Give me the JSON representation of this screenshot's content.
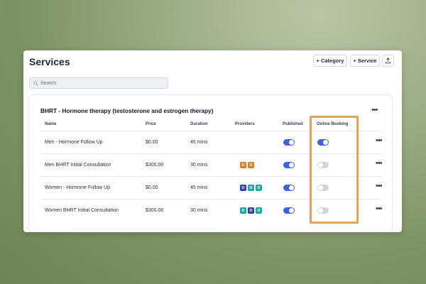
{
  "page": {
    "title": "Services"
  },
  "toolbar": {
    "add_category": "+ Category",
    "add_service": "+ Service",
    "export_icon": "upload-icon"
  },
  "search": {
    "placeholder": "Search",
    "value": ""
  },
  "category": {
    "title": "BHRT - Hormone therapy (testosterone and estrogen therapy)",
    "columns": [
      "Name",
      "Price",
      "Duration",
      "Providers",
      "Published",
      "Online Booking"
    ],
    "rows": [
      {
        "name": "Men - Hormone Follow Up",
        "price": "$0.00",
        "duration": "45 mins",
        "providers": [],
        "published": true,
        "online_booking": true
      },
      {
        "name": "Men BHRT Initial Consultation",
        "price": "$300.00",
        "duration": "30 mins",
        "providers": [
          {
            "letter": "D",
            "color": "#e07b2a"
          },
          {
            "letter": "D",
            "color": "#e07b2a"
          }
        ],
        "published": true,
        "online_booking": false
      },
      {
        "name": "Women - Hormone Follow Up",
        "price": "$0.00",
        "duration": "45 mins",
        "providers": [
          {
            "letter": "D",
            "color": "#2f3fb0"
          },
          {
            "letter": "D",
            "color": "#1ea7a0"
          },
          {
            "letter": "D",
            "color": "#1ea7a0"
          }
        ],
        "published": true,
        "online_booking": false
      },
      {
        "name": "Women BHRT Initial Consultation",
        "price": "$300.00",
        "duration": "30 mins",
        "providers": [
          {
            "letter": "D",
            "color": "#1ea7a0"
          },
          {
            "letter": "D",
            "color": "#2f3fb0"
          },
          {
            "letter": "D",
            "color": "#1ea7a0"
          }
        ],
        "published": true,
        "online_booking": false
      }
    ]
  },
  "colors": {
    "toggle_on": "#3b65e0",
    "toggle_off": "#d1d5db",
    "highlight": "#e0a45c"
  }
}
